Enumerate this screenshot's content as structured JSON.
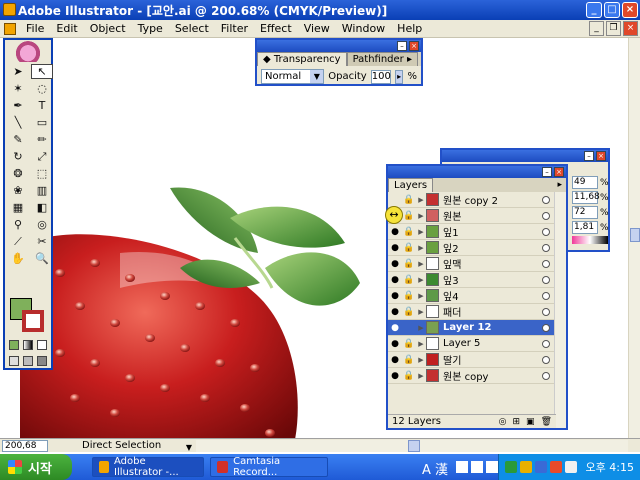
{
  "window": {
    "title": "Adobe Illustrator - [교안.ai @ 200.68% (CMYK/Preview)]"
  },
  "menu": [
    "File",
    "Edit",
    "Object",
    "Type",
    "Select",
    "Filter",
    "Effect",
    "View",
    "Window",
    "Help"
  ],
  "transparency": {
    "tabs": [
      "Transparency",
      "Pathfinder"
    ],
    "mode": "Normal",
    "opacity_label": "Opacity",
    "opacity_value": "100",
    "pct": "%"
  },
  "back_palette": {
    "values": [
      "49",
      "11,68",
      "72",
      "1,81"
    ],
    "pct": "%"
  },
  "layers": {
    "tab": "Layers",
    "rows": [
      {
        "name": "원본 copy 2",
        "thumb": "#c43030"
      },
      {
        "name": "원본",
        "thumb": "#d06060"
      },
      {
        "name": "잎1",
        "thumb": "#6aa040"
      },
      {
        "name": "잎2",
        "thumb": "#6aa040"
      },
      {
        "name": "잎맥",
        "thumb": "#ffffff"
      },
      {
        "name": "잎3",
        "thumb": "#3c8a30"
      },
      {
        "name": "잎4",
        "thumb": "#5e9a48"
      },
      {
        "name": "패더",
        "thumb": "#ffffff"
      },
      {
        "name": "Layer 12",
        "thumb": "#7aa050"
      },
      {
        "name": "Layer 5",
        "thumb": "#ffffff"
      },
      {
        "name": "딸기",
        "thumb": "#c02020"
      },
      {
        "name": "원본 copy",
        "thumb": "#c43030"
      }
    ],
    "selected_index": 8,
    "count_label": "12 Layers"
  },
  "status": {
    "zoom": "200,68",
    "tool": "Direct Selection"
  },
  "taskbar": {
    "start": "시작",
    "tasks": [
      "Adobe Illustrator -...",
      "Camtasia Record..."
    ],
    "ime": "A 漢",
    "clock": "오후 4:15"
  },
  "colors": {
    "fill": "#7fb05b",
    "stroke": "#b82d2d",
    "title_bar": "#0a3fb5"
  }
}
